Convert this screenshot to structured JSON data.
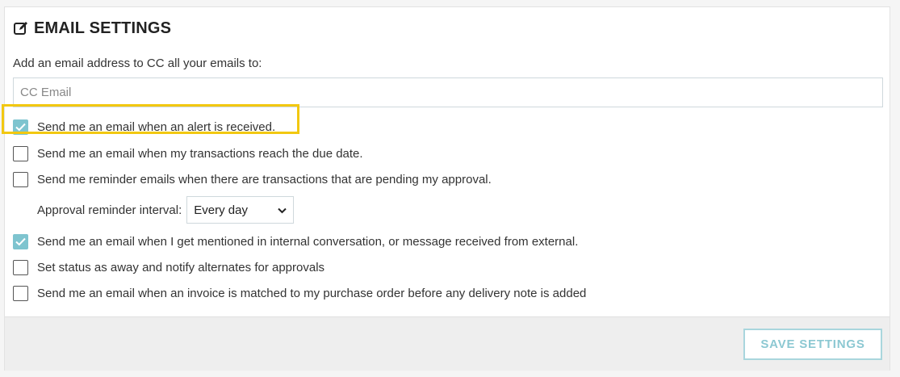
{
  "header": {
    "title": "EMAIL SETTINGS",
    "icon": "edit-icon"
  },
  "cc": {
    "label": "Add an email address to CC all your emails to:",
    "placeholder": "CC Email",
    "value": ""
  },
  "options": [
    {
      "label": "Send me an email when an alert is received.",
      "checked": true
    },
    {
      "label": "Send me an email when my transactions reach the due date.",
      "checked": false
    },
    {
      "label": "Send me reminder emails when there are transactions that are pending my approval.",
      "checked": false
    },
    {
      "label": "Send me an email when I get mentioned in internal conversation, or message received from external.",
      "checked": true
    },
    {
      "label": "Set status as away and notify alternates for approvals",
      "checked": false
    },
    {
      "label": "Send me an email when an invoice is matched to my purchase order before any delivery note is added",
      "checked": false
    }
  ],
  "approval_interval": {
    "label": "Approval reminder interval:",
    "selected": "Every day"
  },
  "footer": {
    "save_label": "SAVE SETTINGS"
  },
  "colors": {
    "accent": "#7ec4cf",
    "highlight": "#f2c811",
    "save_text": "#8cc8d2"
  }
}
